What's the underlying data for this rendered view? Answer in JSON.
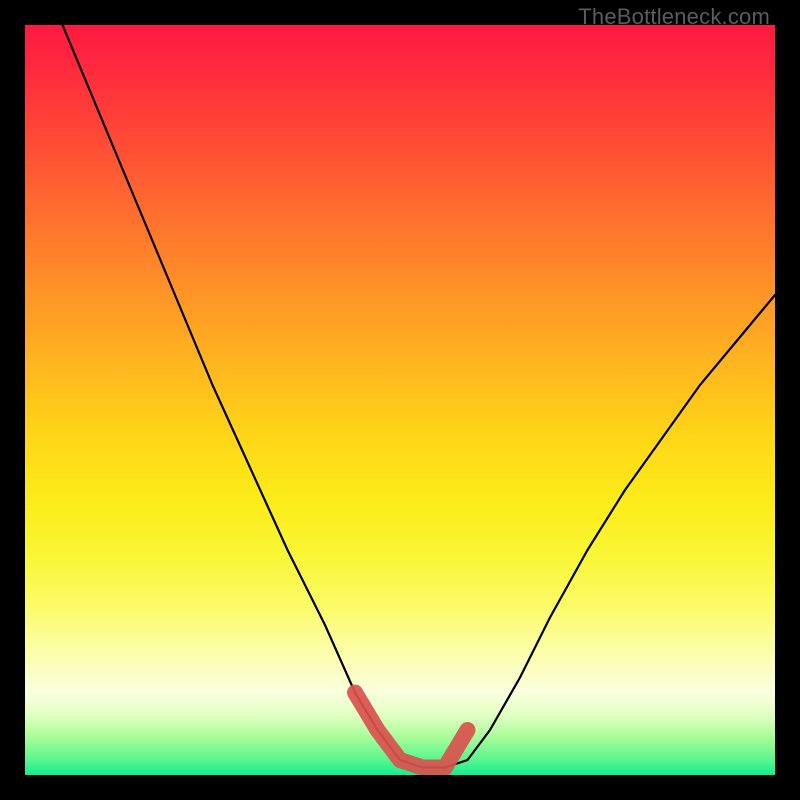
{
  "watermark": "TheBottleneck.com",
  "chart_data": {
    "type": "line",
    "title": "",
    "xlabel": "",
    "ylabel": "",
    "xlim": [
      0,
      100
    ],
    "ylim": [
      0,
      100
    ],
    "annotations": [],
    "series": [
      {
        "name": "curve",
        "color": "#000000",
        "x": [
          5,
          10,
          15,
          20,
          25,
          30,
          35,
          40,
          44,
          47,
          50,
          53,
          56,
          59,
          62,
          66,
          70,
          75,
          80,
          85,
          90,
          95,
          100
        ],
        "y": [
          100,
          88,
          76,
          64,
          52,
          41,
          30,
          20,
          11,
          6,
          2,
          1,
          1,
          2,
          6,
          13,
          21,
          30,
          38,
          45,
          52,
          58,
          64
        ]
      },
      {
        "name": "highlight",
        "color": "#d9514e",
        "x": [
          44,
          47,
          50,
          53,
          56,
          59
        ],
        "y": [
          11,
          6,
          2,
          1,
          1,
          6
        ]
      }
    ],
    "background_gradient": {
      "direction": "vertical",
      "stops": [
        {
          "pos": 0.0,
          "color": "#ff1a3f"
        },
        {
          "pos": 0.5,
          "color": "#ffd618"
        },
        {
          "pos": 0.85,
          "color": "#fcfeae"
        },
        {
          "pos": 1.0,
          "color": "#15ed8e"
        }
      ]
    }
  }
}
